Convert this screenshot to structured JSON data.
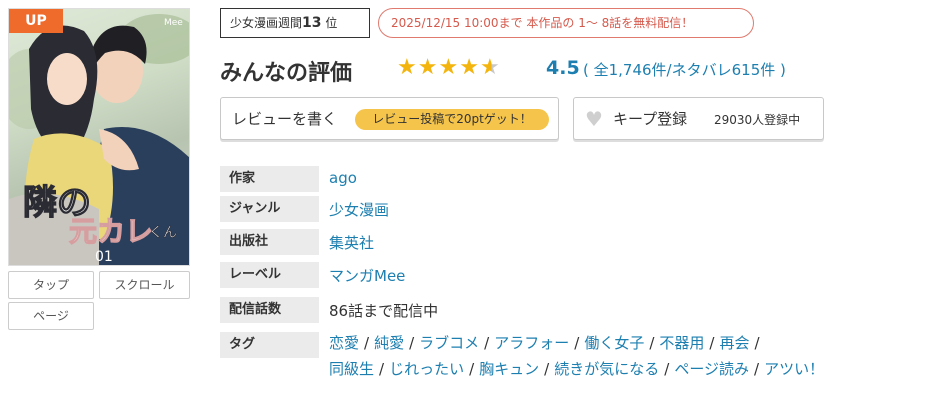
{
  "cover": {
    "badge": "UP",
    "title_art": "隣の元カレくん",
    "volume": "01",
    "imprint": "Mee"
  },
  "view_modes": {
    "tap": "タップ",
    "scroll": "スクロール",
    "page": "ページ"
  },
  "ranking": {
    "prefix": "少女漫画週間",
    "rank": "13",
    "suffix": "位"
  },
  "free_notice": "2025/12/15 10:00まで 本作品の 1～ 8話を無料配信！",
  "rating": {
    "title": "みんなの評価",
    "stars": 4.5,
    "value": "4.5",
    "counts": "( 全1,746件/ネタバレ615件 )"
  },
  "review_button": {
    "label": "レビューを書く",
    "promo": "レビュー投稿で20ptゲット！"
  },
  "keep_button": {
    "label": "キープ登録",
    "count": "29030人登録中"
  },
  "info": {
    "author_key": "作家",
    "author": "ago",
    "genre_key": "ジャンル",
    "genre": "少女漫画",
    "publisher_key": "出版社",
    "publisher": "集英社",
    "label_key": "レーベル",
    "label": "マンガMee",
    "episodes_key": "配信話数",
    "episodes": "86話まで配信中",
    "tags_key": "タグ",
    "tags": [
      "恋愛",
      "純愛",
      "ラブコメ",
      "アラフォー",
      "働く女子",
      "不器用",
      "再会",
      "同級生",
      "じれったい",
      "胸キュン",
      "続きが気になる",
      "ページ読み",
      "アツい！"
    ]
  },
  "colors": {
    "accent_orange": "#ef6b2c",
    "link_blue": "#1d7fb0",
    "star_gold": "#f3b40e",
    "promo_yellow": "#f5c44b",
    "notice_red": "#d5594c"
  }
}
